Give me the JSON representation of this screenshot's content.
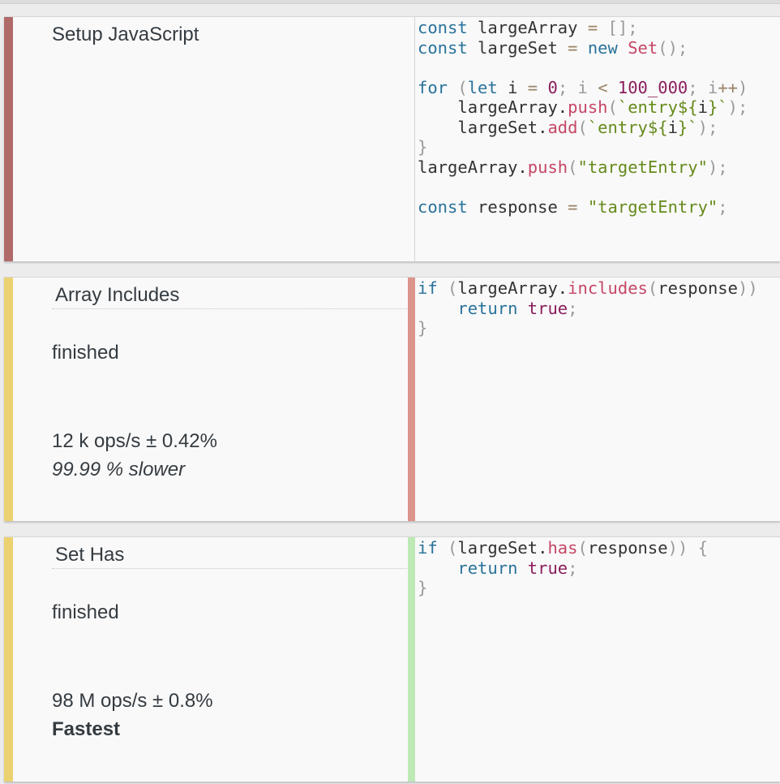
{
  "setup": {
    "title": "Setup JavaScript",
    "code": {
      "l1": {
        "kw": "const",
        "name": " largeArray ",
        "eq": "=",
        "rest": " [];"
      },
      "l2": {
        "kw": "const",
        "name": " largeSet ",
        "eq": "=",
        "new": " new ",
        "cls": "Set",
        "rest": "();"
      },
      "l4": {
        "kw": "for",
        "open": " (",
        "let": "let",
        "i": " i ",
        "eq": "=",
        "zero": " 0",
        "semi1": "; i ",
        "lt": "<",
        "sp": " ",
        "num": "100_000",
        "semi2": "; i",
        "inc": "++",
        "close": ")"
      },
      "l5": {
        "indent": "    largeArray.",
        "fn": "push",
        "p1": "(",
        "s1": "`entry${",
        "v": "i",
        "s2": "}`",
        "p2": ");"
      },
      "l6": {
        "indent": "    largeSet.",
        "fn": "add",
        "p1": "(",
        "s1": "`entry${",
        "v": "i",
        "s2": "}`",
        "p2": ");"
      },
      "l7": "}",
      "l8": {
        "obj": "largeArray.",
        "fn": "push",
        "p1": "(",
        "str": "\"targetEntry\"",
        "p2": ");"
      },
      "l10": {
        "kw": "const",
        "name": " response ",
        "eq": "=",
        "sp": " ",
        "str": "\"targetEntry\"",
        "semi": ";"
      }
    }
  },
  "tests": [
    {
      "title": "Array Includes",
      "status": "finished",
      "ops": "12 k ops/s ± 0.42%",
      "comparison": "99.99 % slower",
      "code": {
        "kw": "if",
        "open": " (",
        "obj": "largeArray.",
        "fn": "includes",
        "p1": "(",
        "arg": "response",
        "p2": ")",
        "p3": ")",
        "ret": "    return ",
        "val": "true",
        "semi": ";",
        "close": "}"
      },
      "accent_color": "#dc948c"
    },
    {
      "title": "Set Has",
      "status": "finished",
      "ops": "98 M ops/s ± 0.8%",
      "comparison": "Fastest",
      "code": {
        "kw": "if",
        "open": " (",
        "obj": "largeSet.",
        "fn": "has",
        "p1": "(",
        "arg": "response",
        "p2": ")",
        "p3": ")",
        "brace": " {",
        "ret": "    return ",
        "val": "true",
        "semi": ";",
        "close": "}"
      },
      "accent_color": "#bde9b5"
    }
  ]
}
